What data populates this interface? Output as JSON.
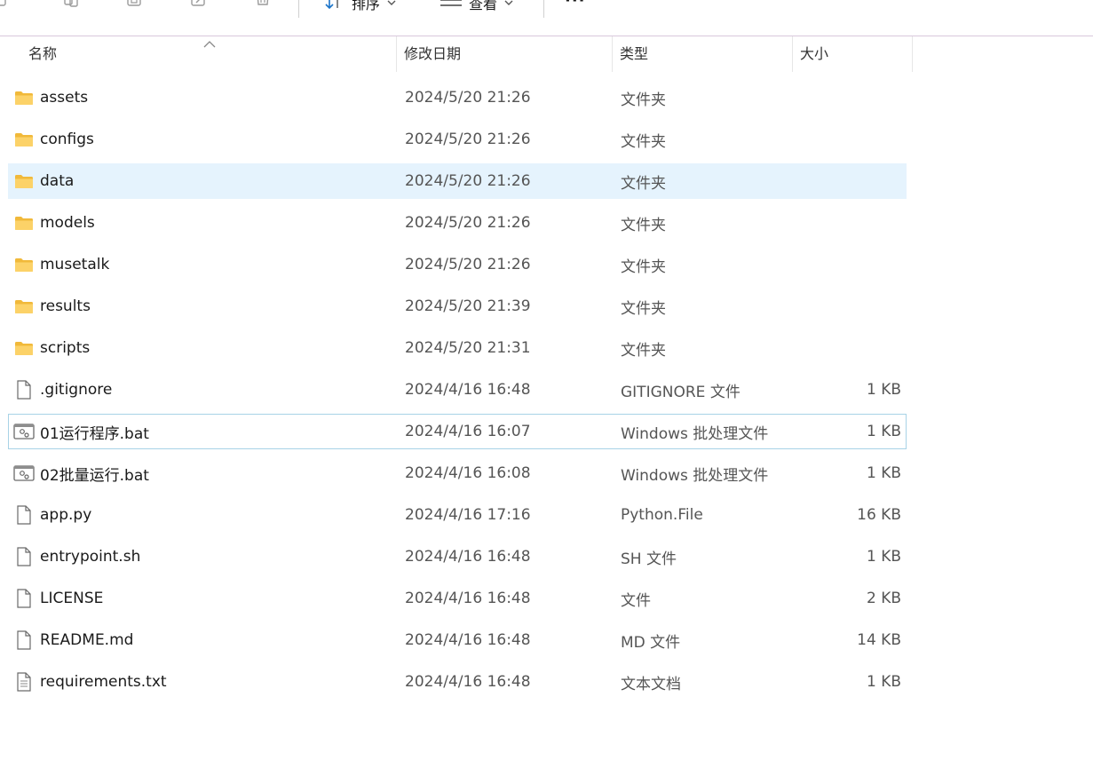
{
  "toolbar": {
    "sort_label": "排序",
    "view_label": "查看",
    "more_label": "···"
  },
  "columns": {
    "name": "名称",
    "date": "修改日期",
    "type": "类型",
    "size": "大小"
  },
  "files": [
    {
      "name": "assets",
      "date": "2024/5/20 21:26",
      "type": "文件夹",
      "size": "",
      "icon": "folder-icon"
    },
    {
      "name": "configs",
      "date": "2024/5/20 21:26",
      "type": "文件夹",
      "size": "",
      "icon": "folder-icon"
    },
    {
      "name": "data",
      "date": "2024/5/20 21:26",
      "type": "文件夹",
      "size": "",
      "icon": "folder-icon",
      "state": "selected"
    },
    {
      "name": "models",
      "date": "2024/5/20 21:26",
      "type": "文件夹",
      "size": "",
      "icon": "folder-icon"
    },
    {
      "name": "musetalk",
      "date": "2024/5/20 21:26",
      "type": "文件夹",
      "size": "",
      "icon": "folder-icon"
    },
    {
      "name": "results",
      "date": "2024/5/20 21:39",
      "type": "文件夹",
      "size": "",
      "icon": "folder-icon"
    },
    {
      "name": "scripts",
      "date": "2024/5/20 21:31",
      "type": "文件夹",
      "size": "",
      "icon": "folder-icon"
    },
    {
      "name": ".gitignore",
      "date": "2024/4/16 16:48",
      "type": "GITIGNORE 文件",
      "size": "1 KB",
      "icon": "file-icon"
    },
    {
      "name": "01运行程序.bat",
      "date": "2024/4/16 16:07",
      "type": "Windows 批处理文件",
      "size": "1 KB",
      "icon": "batch-file-icon",
      "state": "focused"
    },
    {
      "name": "02批量运行.bat",
      "date": "2024/4/16 16:08",
      "type": "Windows 批处理文件",
      "size": "1 KB",
      "icon": "batch-file-icon"
    },
    {
      "name": "app.py",
      "date": "2024/4/16 17:16",
      "type": "Python.File",
      "size": "16 KB",
      "icon": "file-icon"
    },
    {
      "name": "entrypoint.sh",
      "date": "2024/4/16 16:48",
      "type": "SH 文件",
      "size": "1 KB",
      "icon": "file-icon"
    },
    {
      "name": "LICENSE",
      "date": "2024/4/16 16:48",
      "type": "文件",
      "size": "2 KB",
      "icon": "file-icon"
    },
    {
      "name": "README.md",
      "date": "2024/4/16 16:48",
      "type": "MD 文件",
      "size": "14 KB",
      "icon": "file-icon"
    },
    {
      "name": "requirements.txt",
      "date": "2024/4/16 16:48",
      "type": "文本文档",
      "size": "1 KB",
      "icon": "text-document-icon"
    }
  ],
  "colors": {
    "selected_bg": "#e5f3fd",
    "focus_border": "#a8d3e6",
    "folder": "#f8c94a",
    "accent": "#1a73c8"
  }
}
